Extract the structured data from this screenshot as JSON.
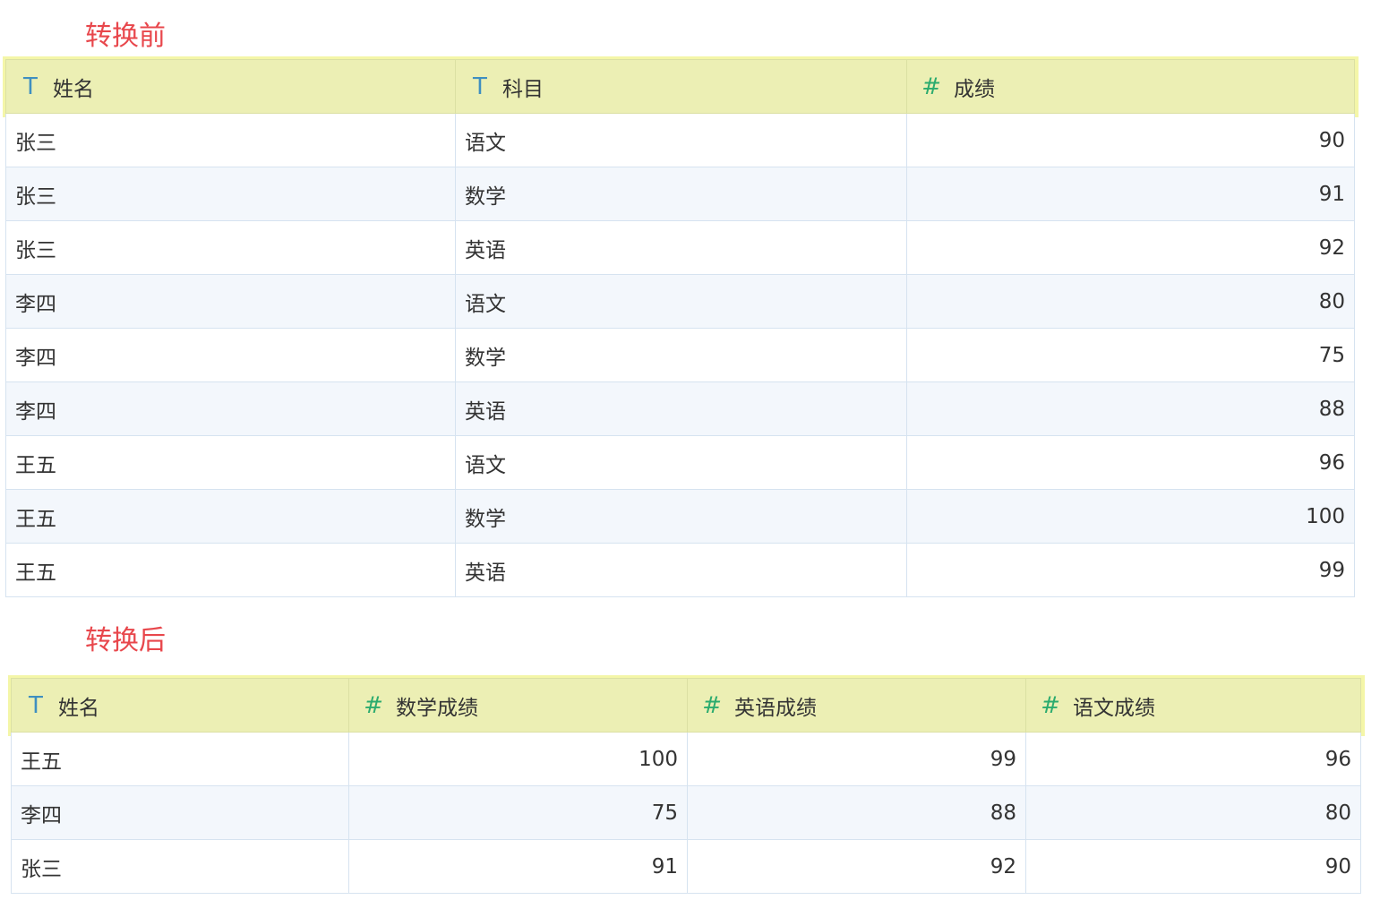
{
  "before": {
    "title": "转换前",
    "columns": [
      {
        "type_icon": "T",
        "label": "姓名"
      },
      {
        "type_icon": "T",
        "label": "科目"
      },
      {
        "type_icon": "#",
        "label": "成绩"
      }
    ],
    "rows": [
      [
        "张三",
        "语文",
        "90"
      ],
      [
        "张三",
        "数学",
        "91"
      ],
      [
        "张三",
        "英语",
        "92"
      ],
      [
        "李四",
        "语文",
        "80"
      ],
      [
        "李四",
        "数学",
        "75"
      ],
      [
        "李四",
        "英语",
        "88"
      ],
      [
        "王五",
        "语文",
        "96"
      ],
      [
        "王五",
        "数学",
        "100"
      ],
      [
        "王五",
        "英语",
        "99"
      ]
    ]
  },
  "after": {
    "title": "转换后",
    "columns": [
      {
        "type_icon": "T",
        "label": "姓名"
      },
      {
        "type_icon": "#",
        "label": "数学成绩"
      },
      {
        "type_icon": "#",
        "label": "英语成绩"
      },
      {
        "type_icon": "#",
        "label": "语文成绩"
      }
    ],
    "rows": [
      [
        "王五",
        "100",
        "99",
        "96"
      ],
      [
        "李四",
        "75",
        "88",
        "80"
      ],
      [
        "张三",
        "91",
        "92",
        "90"
      ]
    ]
  },
  "colors": {
    "title": "#e8474c",
    "header_bg": "#ecefb4",
    "text_type_icon": "#3f8fc0",
    "number_type_icon": "#2bab6e",
    "row_alt_bg": "#f3f7fc",
    "border": "#d6e3f0"
  }
}
